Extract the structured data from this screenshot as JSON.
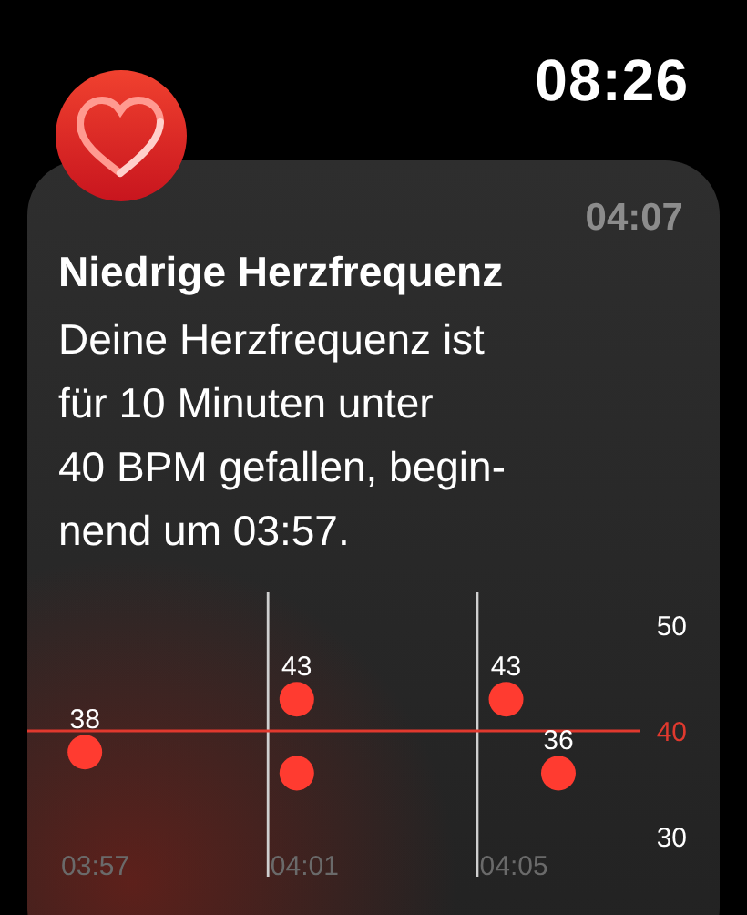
{
  "status_bar": {
    "time": "08:26"
  },
  "notification": {
    "time": "04:07",
    "title": "Niedrige Herzfrequenz",
    "body_lines": [
      "Deine Herzfrequenz ist",
      "für 10 Minuten unter",
      "40 BPM gefallen, begin-",
      "nend um 03:57."
    ],
    "chart_data": {
      "type": "scatter",
      "x": [
        236.8,
        240.85,
        240.85,
        244.85,
        245.85
      ],
      "series": [
        {
          "color": "#ff3b30",
          "values": [
            38,
            43,
            36,
            43,
            36
          ]
        }
      ],
      "value_labels": [
        "38",
        "43",
        null,
        "43",
        "36"
      ],
      "xticks": [
        {
          "value": 237,
          "label": "03:57"
        },
        {
          "value": 241,
          "label": "04:01"
        },
        {
          "value": 245,
          "label": "04:05"
        }
      ],
      "xlim": [
        235.7,
        247.4
      ],
      "ylim": [
        30,
        50
      ],
      "yticks": [
        50,
        40,
        30
      ],
      "ref_lines": [
        {
          "axis": "y",
          "value": 40,
          "color": "#e0392e"
        },
        {
          "axis": "x",
          "value": 240.3,
          "color": "#cfcfcf"
        },
        {
          "axis": "x",
          "value": 244.3,
          "color": "#cfcfcf"
        }
      ]
    }
  }
}
